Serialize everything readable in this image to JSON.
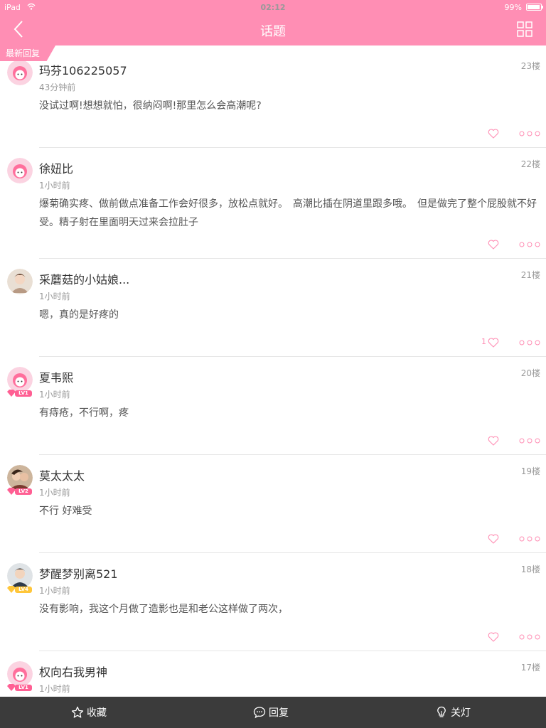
{
  "status_bar": {
    "carrier": "iPad",
    "time": "02:12",
    "battery": "99%"
  },
  "nav": {
    "title": "话题"
  },
  "ribbon": {
    "label": "最新回复"
  },
  "colors": {
    "accent": "#ff8eb4",
    "bottom_bar": "#3b3b3b"
  },
  "replies": [
    {
      "name": "玛芬106225057",
      "time": "43分钟前",
      "floor": "23楼",
      "content": "没试过啊!想想就怕，很纳闷啊!那里怎么会高潮呢?",
      "likes": "",
      "level": "",
      "avatar_icon": "default-avatar-icon"
    },
    {
      "name": "徐妞比",
      "time": "1小时前",
      "floor": "22楼",
      "content": "爆菊确实疼、做前做点准备工作会好很多，放松点就好。　高潮比插在阴道里跟多哦。　但是做完了整个屁股就不好受。精子射在里面明天过来会拉肚子",
      "likes": "",
      "level": "",
      "avatar_icon": "default-avatar-icon"
    },
    {
      "name": "采蘑菇的小姑娘...",
      "time": "1小时前",
      "floor": "21楼",
      "content": "嗯，真的是好疼的",
      "likes": "1",
      "level": "",
      "avatar_icon": "photo-avatar-icon"
    },
    {
      "name": "夏韦熙",
      "time": "1小时前",
      "floor": "20楼",
      "content": "有痔疮，不行啊，疼",
      "likes": "",
      "level": "LV1",
      "avatar_icon": "default-avatar-icon"
    },
    {
      "name": "莫太太太",
      "time": "1小时前",
      "floor": "19楼",
      "content": "不行 好难受",
      "likes": "",
      "level": "LV2",
      "avatar_icon": "photo-avatar-icon"
    },
    {
      "name": "梦醒梦别离521",
      "time": "1小时前",
      "floor": "18楼",
      "content": "没有影响，我这个月做了造影也是和老公这样做了两次，",
      "likes": "",
      "level": "LV4",
      "avatar_icon": "photo-avatar-icon"
    },
    {
      "name": "权向右我男神",
      "time": "1小时前",
      "floor": "17楼",
      "content": "",
      "likes": "",
      "level": "LV1",
      "avatar_icon": "default-avatar-icon"
    }
  ],
  "bottom_bar": {
    "favorite": "收藏",
    "reply": "回复",
    "lights_off": "关灯"
  }
}
